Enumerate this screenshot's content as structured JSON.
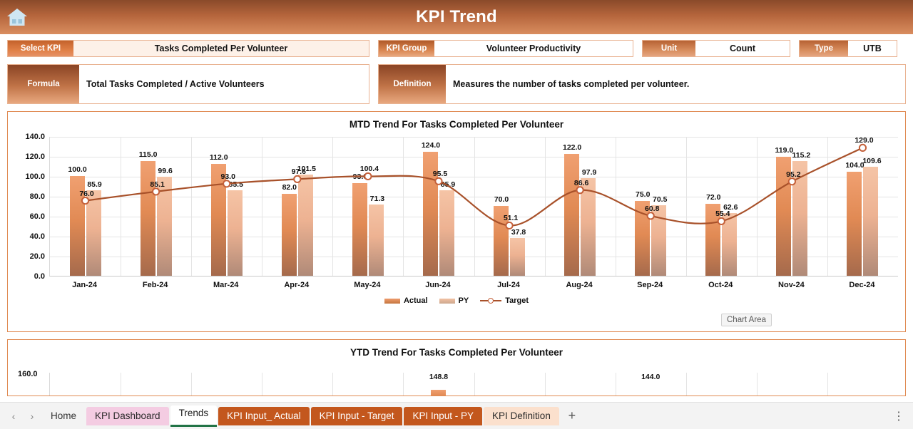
{
  "header": {
    "title": "KPI Trend",
    "home_icon": "home-icon"
  },
  "meta": {
    "select_kpi_label": "Select KPI",
    "select_kpi_value": "Tasks Completed Per Volunteer",
    "kpi_group_label": "KPI Group",
    "kpi_group_value": "Volunteer Productivity",
    "unit_label": "Unit",
    "unit_value": "Count",
    "type_label": "Type",
    "type_value": "UTB",
    "formula_label": "Formula",
    "formula_value": "Total Tasks Completed / Active Volunteers",
    "definition_label": "Definition",
    "definition_value": "Measures the number of tasks completed per volunteer."
  },
  "tooltip": {
    "chart_area": "Chart Area"
  },
  "legend": {
    "actual": "Actual",
    "py": "PY",
    "target": "Target"
  },
  "chart_data": [
    {
      "type": "bar",
      "title": "MTD Trend For Tasks Completed Per Volunteer",
      "xlabel": "",
      "ylabel": "",
      "ylim": [
        0,
        140
      ],
      "yticks": [
        "0.0",
        "20.0",
        "40.0",
        "60.0",
        "80.0",
        "100.0",
        "120.0",
        "140.0"
      ],
      "grid": true,
      "legend_position": "bottom",
      "categories": [
        "Jan-24",
        "Feb-24",
        "Mar-24",
        "Apr-24",
        "May-24",
        "Jun-24",
        "Jul-24",
        "Aug-24",
        "Sep-24",
        "Oct-24",
        "Nov-24",
        "Dec-24"
      ],
      "series": [
        {
          "name": "Actual",
          "type": "bar",
          "values": [
            100.0,
            115.0,
            112.0,
            82.0,
            93.0,
            124.0,
            70.0,
            122.0,
            75.0,
            72.0,
            119.0,
            104.0
          ]
        },
        {
          "name": "PY",
          "type": "bar",
          "values": [
            85.9,
            99.6,
            85.5,
            101.5,
            71.3,
            85.9,
            37.8,
            97.9,
            70.5,
            62.6,
            115.2,
            109.6
          ]
        },
        {
          "name": "Target",
          "type": "line",
          "values": [
            76.0,
            85.1,
            93.0,
            97.6,
            100.4,
            95.5,
            51.1,
            86.6,
            60.8,
            55.4,
            95.2,
            129.0
          ]
        }
      ]
    },
    {
      "type": "bar",
      "title": "YTD Trend For Tasks Completed Per Volunteer",
      "ylim": [
        0,
        160
      ],
      "yticks": [
        "160.0"
      ],
      "grid": true,
      "partial_visible_labels": [
        "148.8",
        "144.0"
      ]
    }
  ],
  "tabbar": {
    "prev_icon": "chevron-left-icon",
    "next_icon": "chevron-right-icon",
    "add_icon": "add-sheet-icon",
    "menu_icon": "kebab-menu-icon",
    "tabs": [
      {
        "label": "Home",
        "style": "plain"
      },
      {
        "label": "KPI Dashboard",
        "style": "pink"
      },
      {
        "label": "Trends",
        "style": "active"
      },
      {
        "label": "KPI Input_ Actual",
        "style": "orange"
      },
      {
        "label": "KPI Input - Target",
        "style": "orange"
      },
      {
        "label": "KPI Input - PY",
        "style": "orange"
      },
      {
        "label": "KPI Definition",
        "style": "peach"
      }
    ]
  },
  "colors": {
    "brand_orange": "#c3571d",
    "actual_bar": "#e18a54",
    "py_bar": "#edb292",
    "target_line": "#a8512a",
    "active_tab_underline": "#217346"
  }
}
